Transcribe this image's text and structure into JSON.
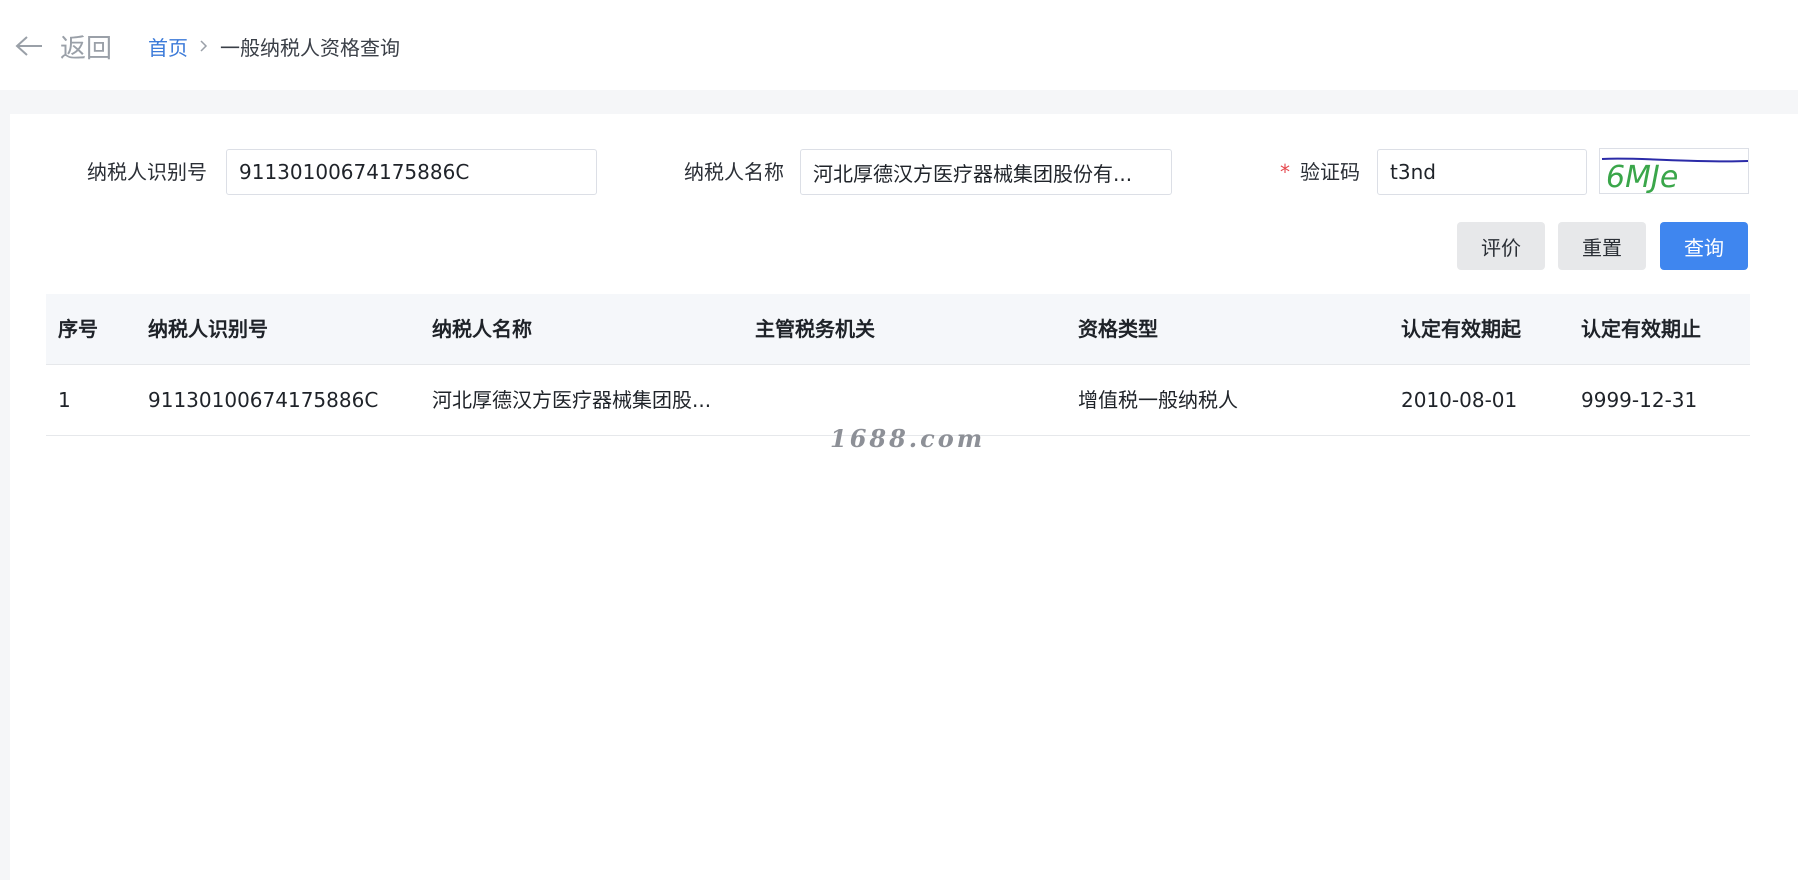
{
  "topbar": {
    "back_label": "返回",
    "breadcrumb": {
      "home": "首页",
      "current": "一般纳税人资格查询"
    }
  },
  "form": {
    "taxpayer_id": {
      "label": "纳税人识别号",
      "value": "91130100674175886C"
    },
    "taxpayer_name": {
      "label": "纳税人名称",
      "value": "河北厚德汉方医疗器械集团股份有..."
    },
    "captcha": {
      "required_mark": "*",
      "label": "验证码",
      "value": "t3nd",
      "image_text": "6MJe"
    }
  },
  "buttons": {
    "evaluate": "评价",
    "reset": "重置",
    "query": "查询"
  },
  "table": {
    "columns": [
      "序号",
      "纳税人识别号",
      "纳税人名称",
      "主管税务机关",
      "资格类型",
      "认定有效期起",
      "认定有效期止"
    ],
    "rows": [
      [
        "1",
        "91130100674175886C",
        "河北厚德汉方医疗器械集团股...",
        "",
        "增值税一般纳税人",
        "2010-08-01",
        "9999-12-31"
      ]
    ]
  },
  "watermark": "1688.com",
  "colors": {
    "primary": "#3f86ef",
    "link": "#3b7ad9",
    "required": "#e5484d",
    "captcha_text": "#3aa64a",
    "captcha_line": "#2b2ba8"
  }
}
